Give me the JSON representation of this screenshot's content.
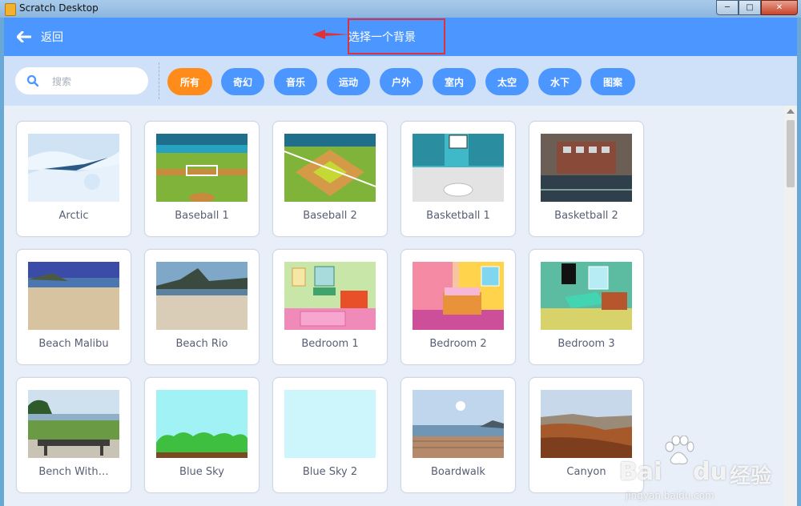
{
  "window": {
    "title": "Scratch Desktop",
    "minimize": "─",
    "maximize": "□",
    "close": "✕"
  },
  "header": {
    "back_label": "返回",
    "title": "选择一个背景"
  },
  "search": {
    "placeholder": "搜索"
  },
  "tags": [
    "所有",
    "奇幻",
    "音乐",
    "运动",
    "户外",
    "室内",
    "太空",
    "水下",
    "图案"
  ],
  "active_tag": "所有",
  "backdrops": [
    "Arctic",
    "Baseball 1",
    "Baseball 2",
    "Basketball 1",
    "Basketball 2",
    "Beach Malibu",
    "Beach Rio",
    "Bedroom 1",
    "Bedroom 2",
    "Bedroom 3",
    "Bench With…",
    "Blue Sky",
    "Blue Sky 2",
    "Boardwalk",
    "Canyon"
  ],
  "watermark": {
    "brand": "Bai",
    "brand2": "du",
    "cn": "经验",
    "url": "jingyan.baidu.com"
  },
  "colors": {
    "primary": "#4c97ff",
    "active_tag": "#ff8c1a",
    "filter_bg": "#cfe0f9",
    "annotation": "#e0303a"
  }
}
